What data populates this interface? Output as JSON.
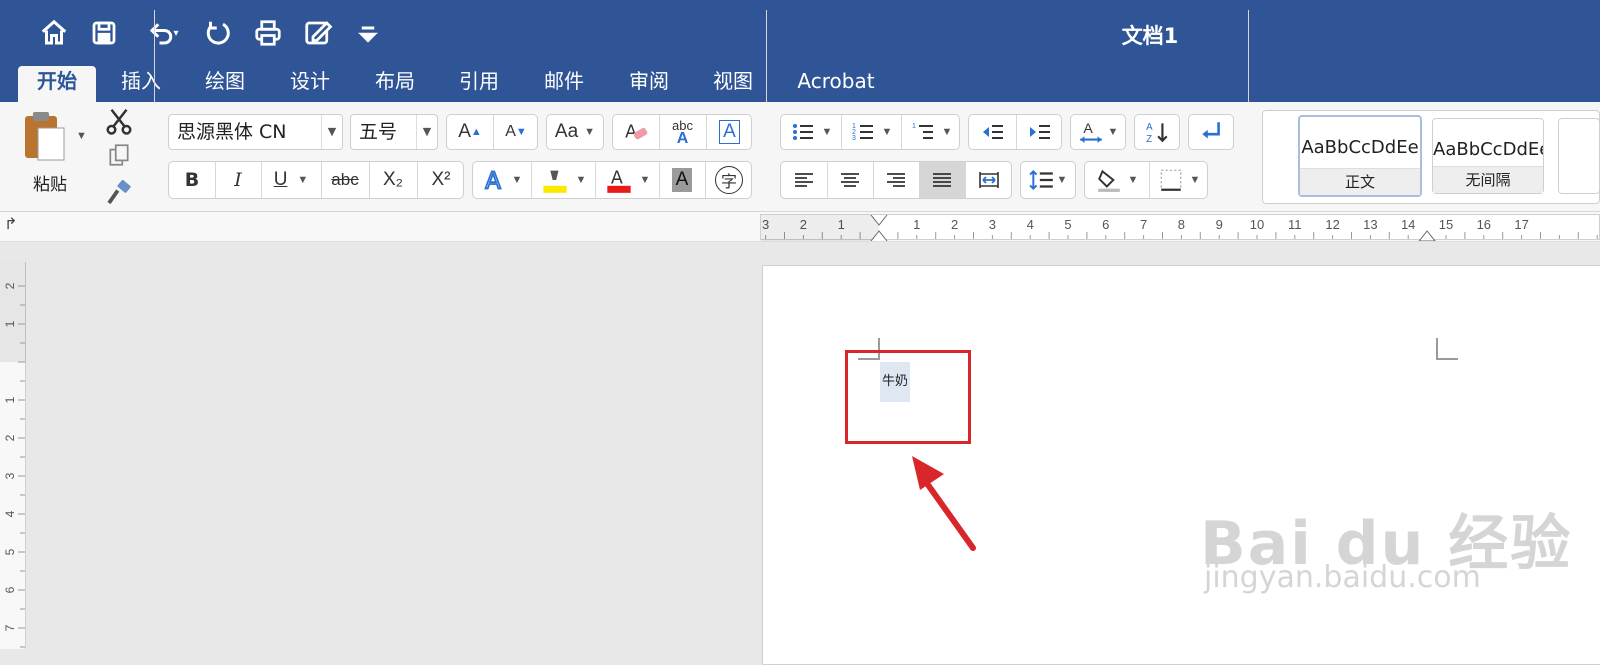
{
  "window": {
    "title": "文档1"
  },
  "quick_access": [
    {
      "icon": "home-icon"
    },
    {
      "icon": "save-icon"
    },
    {
      "icon": "undo-icon"
    },
    {
      "icon": "redo-icon"
    },
    {
      "icon": "print-icon"
    },
    {
      "icon": "edit-doc-icon"
    },
    {
      "icon": "customize-icon"
    }
  ],
  "tabs": [
    {
      "label": "开始",
      "active": true
    },
    {
      "label": "插入"
    },
    {
      "label": "绘图"
    },
    {
      "label": "设计"
    },
    {
      "label": "布局"
    },
    {
      "label": "引用"
    },
    {
      "label": "邮件"
    },
    {
      "label": "审阅"
    },
    {
      "label": "视图"
    },
    {
      "label": "Acrobat"
    }
  ],
  "clipboard": {
    "paste_label": "粘贴"
  },
  "font": {
    "name": "思源黑体 CN",
    "size": "五号",
    "bold": "B",
    "italic": "I",
    "underline": "U",
    "strike": "abc",
    "subscript": "X₂",
    "superscript": "X²",
    "shading_letter": "A",
    "enclose_char": "字",
    "grow": "A",
    "shrink": "A",
    "change_case": "Aa",
    "phonetic": "abc",
    "border_char": "A",
    "highlight_color": "#ffe800",
    "font_color": "#e81a1a"
  },
  "styles": [
    {
      "sample": "AaBbCcDdEe",
      "name": "正文"
    },
    {
      "sample": "AaBbCcDdEe",
      "name": "无间隔"
    }
  ],
  "ruler": {
    "h_left": [
      "3",
      "2",
      "1"
    ],
    "h_right": [
      "1",
      "2",
      "3",
      "4",
      "5",
      "6",
      "7",
      "8",
      "9",
      "10",
      "11",
      "12",
      "13",
      "14",
      "15",
      "16",
      "17"
    ],
    "v_top": [
      "2",
      "1"
    ],
    "v_bottom": [
      "1",
      "2",
      "3",
      "4",
      "5",
      "6",
      "7"
    ]
  },
  "document": {
    "text": "牛奶"
  },
  "watermark": {
    "brand": "Bai du 经验",
    "url": "jingyan.baidu.com"
  },
  "colors": {
    "titlebar": "#2f5596",
    "annotation": "#d8262b"
  }
}
